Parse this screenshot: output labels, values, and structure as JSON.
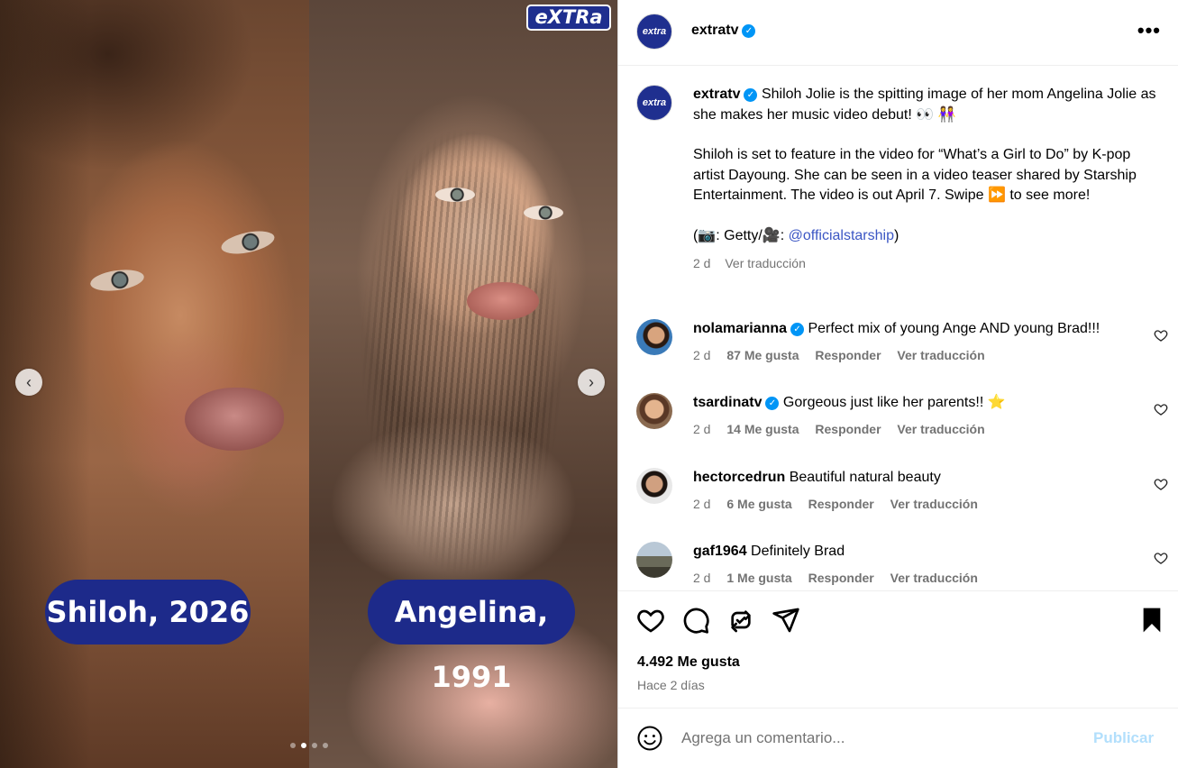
{
  "media": {
    "logo_text": "eXTRa",
    "label_left": "Shiloh, 2026",
    "label_right": "Angelina, 1991",
    "prev_icon": "‹",
    "next_icon": "›",
    "carousel": {
      "slide_count": 4,
      "active_index": 1
    }
  },
  "header": {
    "avatar_text": "extra",
    "username": "extratv",
    "verified": true,
    "more_icon": "•••"
  },
  "caption": {
    "username": "extratv",
    "line1": "Shiloh Jolie is the spitting image of her mom Angelina Jolie as she makes her music video debut! 👀 👭",
    "line2": "Shiloh is set to feature in the video for “What’s a Girl to Do” by K-pop artist Dayoung. She can be seen in a video teaser shared by Starship Entertainment. The video is out April 7. Swipe ⏩ to see more!",
    "credit_prefix": "(📷: Getty/🎥: ",
    "credit_mention": "@officialstarship",
    "credit_suffix": ")",
    "time": "2 d",
    "translate": "Ver traducción"
  },
  "comments": [
    {
      "username": "nolamarianna",
      "verified": true,
      "text": "Perfect mix of young Ange AND young Brad!!!",
      "time": "2 d",
      "likes": "87 Me gusta",
      "reply": "Responder",
      "translate": "Ver traducción"
    },
    {
      "username": "tsardinatv",
      "verified": true,
      "text": "Gorgeous just like her parents!! ⭐",
      "time": "2 d",
      "likes": "14 Me gusta",
      "reply": "Responder",
      "translate": "Ver traducción"
    },
    {
      "username": "hectorcedrun",
      "verified": false,
      "text": "Beautiful natural beauty",
      "time": "2 d",
      "likes": "6 Me gusta",
      "reply": "Responder",
      "translate": "Ver traducción"
    },
    {
      "username": "gaf1964",
      "verified": false,
      "text": "Definitely Brad",
      "time": "2 d",
      "likes": "1 Me gusta",
      "reply": "Responder",
      "translate": "Ver traducción"
    }
  ],
  "actions": {
    "icons": [
      "heart-icon",
      "comment-icon",
      "repost-icon",
      "share-icon",
      "bookmark-icon"
    ],
    "likes": "4.492 Me gusta",
    "posted": "Hace 2 días"
  },
  "add_comment": {
    "placeholder": "Agrega un comentario...",
    "publish": "Publicar"
  },
  "colors": {
    "brand_blue": "#1f2f8f",
    "verified_blue": "#0095f6",
    "link_blue": "#3b56c4",
    "publish_disabled": "#b2dffc",
    "secondary_text": "#737373"
  }
}
